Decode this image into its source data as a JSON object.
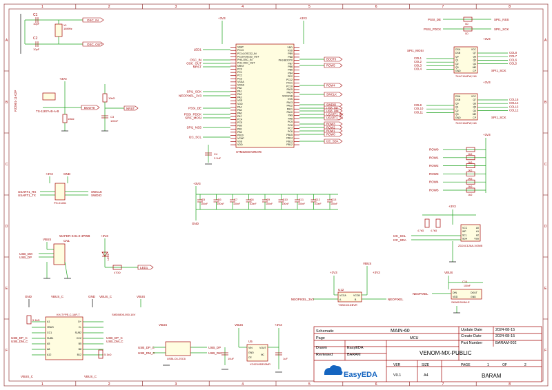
{
  "border": {
    "col_marks": [
      "1",
      "2",
      "3",
      "4",
      "5",
      "6",
      "7",
      "8"
    ],
    "row_marks": [
      "A",
      "B",
      "C",
      "D",
      "E",
      "F"
    ]
  },
  "title_block": {
    "schematic_label": "Schematic",
    "schematic_value": "MAIN-60",
    "page_label": "Page",
    "page_value": "MCU",
    "update_label": "Update Date",
    "update_value": "2024-08-15",
    "create_label": "Create Date",
    "create_value": "2024-08-15",
    "part_label": "Part Number",
    "part_value": "BARAM-002",
    "drawn_label": "Drawn",
    "drawn_value": "EasyEDA",
    "reviewed_label": "Reviewed",
    "reviewed_value": "BARAM",
    "project": "VENOM-MX-PUBLIC",
    "ver_label": "VER",
    "ver_value": "V0.1",
    "size_label": "SIZE",
    "size_value": "A4",
    "page_num_label": "PAGE",
    "page_num": "1",
    "of_label": "OF",
    "page_total": "2",
    "company": "BARAM",
    "logo_text": "EasyEDA"
  },
  "power": {
    "v33": "+3V3",
    "vbus": "VBUS",
    "vbus_c": "VBUS_C",
    "gnd": "GND"
  },
  "crystal": {
    "c1": "C1",
    "c1_val": "10pF",
    "c2": "C2",
    "c2_val": "10pF",
    "x1": "X1",
    "x1_val": "16MHz",
    "osc_in": "OSC_IN",
    "osc_out": "OSC_OUT"
  },
  "boot": {
    "sw_name": "TS-1187A-B-A-B",
    "sw_part": "PZ2001-11-02P",
    "boot0": "BOOT0",
    "r_val": "10kΩ"
  },
  "reset": {
    "r_val": "10kΩ",
    "c_name": "C3",
    "c_val": "100nF",
    "nrst": "NRST"
  },
  "mcu": {
    "name": "STM32G0A0R27E",
    "left_pins": [
      "VBAT",
      "PC13",
      "PC14-OSC32_IN",
      "PC15-OSC32_OUT",
      "PH0-OSC_IN",
      "PH1-OSC_OUT",
      "NRST",
      "PC0",
      "PC1",
      "PC2",
      "PC3",
      "VSSA",
      "VDDA",
      "PA0",
      "PA1",
      "PA2",
      "PA3",
      "VSS",
      "VDD",
      "PA4",
      "PA5",
      "PA6",
      "PA7",
      "PC4",
      "PC5",
      "PB0",
      "PB1",
      "PB2",
      "PB10",
      "VCAP",
      "VSS",
      "VDD"
    ],
    "right_pins": [
      "VDD",
      "VSS",
      "PB9",
      "PB8",
      "PH3-BOOT0",
      "PB7",
      "PB6",
      "PB5",
      "PB4",
      "PD2",
      "PC12",
      "PC11",
      "PC10",
      "PA15",
      "PA14",
      "VDDUSB",
      "VSS",
      "PA13",
      "PA12",
      "PA11",
      "PA10",
      "PA9",
      "PA8",
      "PC9",
      "PC8",
      "PC7",
      "PC6",
      "PB15",
      "PB14",
      "PB13",
      "PB12"
    ],
    "left_nets": [
      "LED1",
      "OSC_IN",
      "OSC_OUT",
      "NRST",
      "SPI1_SCK",
      "NEOPIXEL_3V3",
      "PSSI_DE",
      "PSSI_PDCK",
      "SPI1_MOSI",
      "SPI1_NSS",
      "I2C_SCL"
    ],
    "right_nets": [
      "BOOT0",
      "ROW5",
      "ROW4",
      "SWCLK",
      "SWDIO",
      "USB_DP",
      "USB_DM",
      "USART1_RX",
      "USART1_TX",
      "ROW3",
      "ROW2",
      "ROW1",
      "ROW0",
      "I2C_SDA"
    ],
    "c4": "C4",
    "c4_val": "2.2uF"
  },
  "swd": {
    "name": "PH-01281",
    "nets_left": [
      "USART1_RX",
      "USART1_TX"
    ],
    "nets_right": [
      "SWCLK",
      "SWDIO"
    ]
  },
  "decoupling": {
    "caps": [
      "C5",
      "C6",
      "C7",
      "C8",
      "C9",
      "C10",
      "C11",
      "C12",
      "C13"
    ],
    "value": "100nF"
  },
  "usb_conn": {
    "name": "WAFER-SH1.0-4PWB",
    "ref": "CN1",
    "nets": [
      "USB_DM",
      "USB_DP"
    ]
  },
  "led": {
    "name": "LED1",
    "r_val": "470Ω",
    "net": "LED1"
  },
  "typec": {
    "name": "KH-TYPE-C-16P-T",
    "ref": "USB1",
    "pins_left": [
      "A1",
      "VBUS",
      "CC1",
      "SUB1",
      "A5",
      "A8",
      "A12"
    ],
    "pins_right": [
      "D+",
      "D-",
      "SUB2",
      "CC2",
      "B5",
      "B8",
      "B12"
    ],
    "nets_left": [
      "USB_DP_C",
      "USB_DM_C"
    ],
    "nets_right": [
      "USB_DP_C",
      "USB_DM_C"
    ],
    "r_left": "5.1kΩ",
    "r_right": "5.1kΩ",
    "fuse": "SMD0805-050-16V"
  },
  "esd": {
    "name": "USBLC6-2SC6",
    "nets_left": [
      "USB_DP_C",
      "USB_DM_C"
    ],
    "nets_right": [
      "USB_DP",
      "USB_DM"
    ]
  },
  "ldo": {
    "name": "XC6210B332MR",
    "ref": "U5",
    "pins": [
      "VIN",
      "GND",
      "CE",
      "VOUT",
      "NC"
    ],
    "c_in": "10uF",
    "c_out": "1uF"
  },
  "shift_reg": {
    "u1": "74HC164PW,118",
    "u2": "74HC164PW,118",
    "pins_left": [
      "DSA",
      "DSB",
      "Q0",
      "Q1",
      "Q2",
      "Q3",
      "GND"
    ],
    "pins_right": [
      "VCC",
      "Q7",
      "Q6",
      "Q5",
      "Q4",
      "MR",
      "CP"
    ],
    "cols_a_left": [
      "COL1",
      "COL2",
      "COL3",
      "COL4"
    ],
    "cols_a_right": [
      "COL8",
      "COL7",
      "COL6",
      "COL5"
    ],
    "cols_b_left": [
      "COL9",
      "COL10",
      "COL11"
    ],
    "cols_b_right": [
      "COL15",
      "COL14",
      "COL13",
      "COL12"
    ],
    "mosi": "SPI1_MOSI",
    "sck": "SPI1_SCK"
  },
  "spi_links": {
    "left": [
      "PSSI_DE",
      "PSSI_PDCK"
    ],
    "right": [
      "SPI1_NSS",
      "SPI1_SCK"
    ],
    "r_val": "0Ω"
  },
  "rows": {
    "labels": [
      "ROW0",
      "ROW1",
      "ROW2",
      "ROW3",
      "ROW4",
      "ROW5"
    ],
    "r_val": "1kΩ"
  },
  "eeprom": {
    "name": "ZD24C128A-XGMB",
    "pins": [
      "VCC",
      "WP",
      "SCL",
      "SDA",
      "A0",
      "A1",
      "A2",
      "VSS"
    ],
    "nets": [
      "I2C_SCL",
      "I2C_SDA"
    ],
    "r_val": "4.7kΩ"
  },
  "level_shift": {
    "name": "TXB0101DBVR",
    "ref": "U12",
    "pins": [
      "VCCA",
      "A",
      "GND",
      "VCCB",
      "B",
      "OE"
    ],
    "net_in": "NEOPIXEL_3V3",
    "net_out": "NEOPIXEL"
  },
  "neopixel": {
    "name": "SK6812MINI-E",
    "ref": "LED2",
    "pins": [
      "DIN",
      "VDD",
      "DOUT",
      "GND"
    ],
    "cap": "C14",
    "cap_val": "100nF",
    "net": "NEOPIXEL"
  }
}
